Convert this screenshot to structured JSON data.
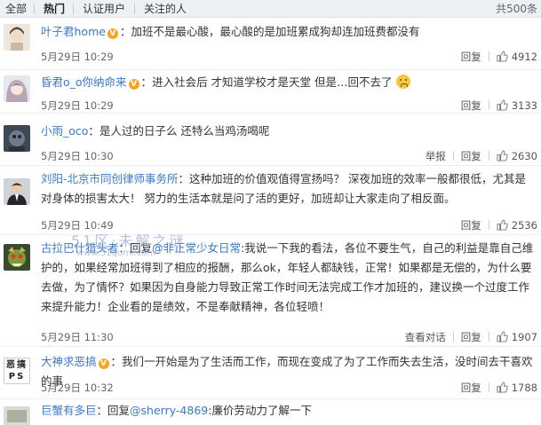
{
  "tabs": {
    "all": "全部",
    "hot": "热门",
    "verified": "认证用户",
    "following": "关注的人",
    "total": "共500条"
  },
  "comments": [
    {
      "user": "叶子君home",
      "verified": true,
      "sep": "：",
      "text": "加班不是最心酸，最心酸的是加班累成狗却连加班费都没有",
      "time": "5月29日 10:29",
      "reply": "回复",
      "likes": "4912"
    },
    {
      "user": "昏君o_o你纳命来",
      "verified": true,
      "sep": "：",
      "text": "进入社会后 才知道学校才是天堂 但是…回不去了",
      "time": "5月29日 10:29",
      "reply": "回复",
      "likes": "3133"
    },
    {
      "user": "小雨_oco",
      "verified": false,
      "sep": "：",
      "text": "是人过的日子么 还特么当鸡汤喝呢",
      "time": "5月29日 10:30",
      "report": "举报",
      "reply": "回复",
      "likes": "2630"
    },
    {
      "user": "刘阳-北京市同创律师事务所",
      "verified": false,
      "sep": "：",
      "text": "这种加班的价值观值得宣扬吗？ 深夜加班的效率一般都很低，尤其是对身体的损害太大！ 努力的生活本就是问了活的更好，加班却让大家走向了相反面。",
      "time": "5月29日 10:49",
      "reply": "回复",
      "likes": "2536"
    },
    {
      "user": "古拉巴什猎头者",
      "verified": false,
      "sep": "：",
      "prefix": "回复",
      "mention": "@非正常少女日常",
      "text": ":我说一下我的看法，各位不要生气，自己的利益是靠自己维护的，如果经常加班得到了相应的报酬，那么ok，年轻人都缺钱，正常！如果都是无偿的，为什么要去做，为了情怀？如果因为自身能力导致正常工作时间无法完成工作才加班的，建议换一个过度工作来提升能力！企业看的是绩效，不是奉献精神，各位轻喷！",
      "time": "5月29日 11:30",
      "view": "查看对话",
      "reply": "回复",
      "likes": "1907"
    },
    {
      "user": "大神求恶搞",
      "verified": true,
      "sep": "：",
      "text": "我们一开始是为了生活而工作，而现在变成了为了工作而失去生活，没时间去干喜欢的事",
      "time": "5月29日 10:32",
      "reply": "回复",
      "likes": "1788"
    },
    {
      "user": "巨蟹有多巨",
      "verified": false,
      "sep": "：",
      "prefix": "回复",
      "mention": "@sherry-4869",
      "text": ":廉价劳动力了解一下"
    }
  ],
  "watermark": {
    "line1": "51区·未解之谜",
    "line2": "www.51qumi.com"
  },
  "avatar_text_6": "恶搞PS",
  "colors": {
    "link": "#3a78c8",
    "tab_bg": "#eef1f4",
    "vip": "#f5a623"
  }
}
